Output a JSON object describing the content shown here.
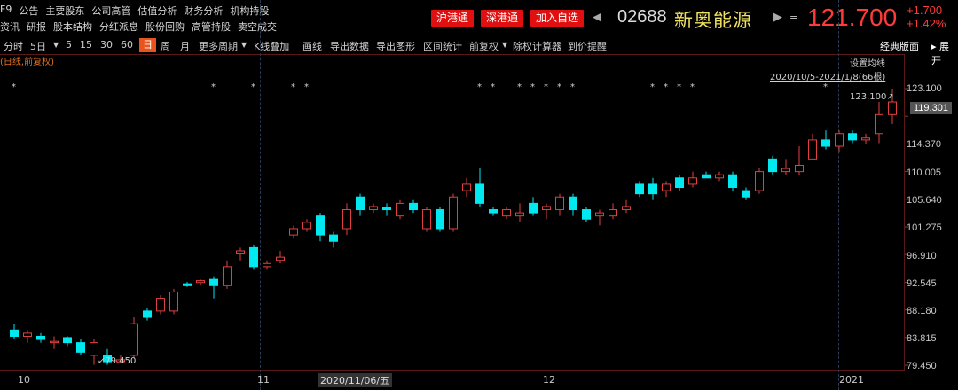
{
  "menu": {
    "row1": [
      "F9",
      "公告",
      "主要股东",
      "公司高管",
      "估值分析",
      "财务分析",
      "机构持股"
    ],
    "row2": [
      "资讯",
      "研报",
      "股本结构",
      "分红派息",
      "股份回购",
      "高管持股",
      "卖空成交"
    ]
  },
  "badges": [
    "沪港通",
    "深港通",
    "加入自选"
  ],
  "stock": {
    "code": "02688",
    "name": "新奥能源",
    "price": "121.700",
    "change": "+1.700",
    "change_pct": "+1.42%"
  },
  "toolbar": {
    "items": [
      "分时",
      "5日",
      "5",
      "15",
      "30",
      "60",
      "日",
      "周",
      "月",
      "更多周期",
      "K线叠加",
      "画线",
      "导出数据",
      "导出图形",
      "区间统计",
      "前复权",
      "除权计算器",
      "到价提醒"
    ],
    "active": "日",
    "right1": "经典版面",
    "right2": "展开"
  },
  "chart_labels": {
    "period_label": "(日线,前复权)",
    "set_ma": "设置均线",
    "range": "2020/10/5-2021/1/8(66根)",
    "high_label": "123.100",
    "low_label": "79.450",
    "current_tag": "119.301"
  },
  "colors": {
    "up": "#e04040",
    "down": "#00e8f0",
    "bg": "#000000",
    "accent": "#ff3a3a"
  },
  "chart_data": {
    "type": "candlestick",
    "yticks": [
      "123.100",
      "118.735",
      "114.370",
      "110.005",
      "105.640",
      "101.275",
      "96.910",
      "92.545",
      "88.180",
      "83.815",
      "79.450"
    ],
    "ylim": [
      79.45,
      123.1
    ],
    "xticks": [
      "10",
      "11",
      "2020/11/06/五",
      "12",
      "2021"
    ],
    "candles": [
      [
        85,
        84,
        86,
        83.5,
        0
      ],
      [
        84,
        84.5,
        85,
        83,
        1
      ],
      [
        84,
        83.5,
        84.5,
        83,
        0
      ],
      [
        83,
        83.2,
        84,
        82,
        1
      ],
      [
        83,
        83.8,
        84,
        82.5,
        0
      ],
      [
        83,
        81.5,
        83.5,
        81,
        0
      ],
      [
        81,
        83,
        83.5,
        79.5,
        1
      ],
      [
        81,
        80,
        82,
        79.5,
        0
      ],
      [
        80,
        80.3,
        81,
        79.8,
        1
      ],
      [
        81,
        86,
        87,
        80.5,
        1
      ],
      [
        87,
        88,
        88.5,
        86.5,
        0
      ],
      [
        88,
        90,
        90.5,
        87.5,
        1
      ],
      [
        88,
        91,
        91.5,
        87.5,
        1
      ],
      [
        92,
        92.3,
        92.6,
        91.8,
        0
      ],
      [
        92.5,
        92.8,
        93,
        92,
        1
      ],
      [
        93,
        92,
        93.5,
        90,
        0
      ],
      [
        92,
        95,
        96,
        91.5,
        1
      ],
      [
        97,
        97.5,
        98,
        96,
        1
      ],
      [
        98,
        95,
        98.5,
        94.5,
        0
      ],
      [
        95,
        95.5,
        96,
        94.5,
        1
      ],
      [
        96,
        96.5,
        97.5,
        95.5,
        1
      ],
      [
        100,
        101,
        101.5,
        99.5,
        1
      ],
      [
        101,
        102,
        102.5,
        100.5,
        1
      ],
      [
        103,
        100,
        103.5,
        99,
        0
      ],
      [
        100,
        99,
        100.5,
        98,
        0
      ],
      [
        101,
        104,
        105,
        100,
        1
      ],
      [
        106,
        104,
        106.5,
        103,
        0
      ],
      [
        104,
        104.5,
        105,
        103.5,
        1
      ],
      [
        104,
        104.3,
        105,
        103,
        0
      ],
      [
        103,
        105,
        105.5,
        102.5,
        1
      ],
      [
        105,
        104,
        105.5,
        103.5,
        0
      ],
      [
        101,
        104,
        104.5,
        100.5,
        1
      ],
      [
        104,
        101,
        104.5,
        100.5,
        0
      ],
      [
        101,
        106,
        106.5,
        100.5,
        1
      ],
      [
        107,
        108,
        109,
        106,
        1
      ],
      [
        108,
        105,
        110.5,
        104.5,
        0
      ],
      [
        104,
        103.5,
        104.5,
        103,
        0
      ],
      [
        103,
        104,
        104.5,
        102.5,
        1
      ],
      [
        103,
        103.5,
        105,
        102,
        1
      ],
      [
        105,
        103.5,
        106,
        103,
        0
      ],
      [
        104,
        104.5,
        105,
        102.5,
        1
      ],
      [
        104,
        106,
        106.5,
        103,
        1
      ],
      [
        106,
        104,
        106.5,
        103,
        0
      ],
      [
        104,
        102.5,
        104.5,
        102,
        0
      ],
      [
        103,
        103.5,
        104,
        101.5,
        1
      ],
      [
        103,
        104,
        105,
        102.5,
        1
      ],
      [
        104,
        104.5,
        105.5,
        103.5,
        1
      ],
      [
        108,
        106.5,
        108.5,
        106,
        0
      ],
      [
        108,
        106.5,
        109,
        105.5,
        0
      ],
      [
        107,
        108,
        108.5,
        106,
        1
      ],
      [
        109,
        107.5,
        109.5,
        107,
        0
      ],
      [
        108,
        109,
        110,
        107.5,
        1
      ],
      [
        109,
        109.5,
        110,
        109,
        0
      ],
      [
        109,
        109.5,
        110,
        108.5,
        1
      ],
      [
        109.5,
        107.5,
        110,
        107,
        0
      ],
      [
        107,
        106,
        107.5,
        105.5,
        0
      ],
      [
        107,
        110,
        110.5,
        106.5,
        1
      ],
      [
        112,
        110,
        112.5,
        109.5,
        0
      ],
      [
        110,
        110.5,
        112,
        109.5,
        1
      ],
      [
        110,
        111,
        114,
        109.5,
        1
      ],
      [
        112,
        115,
        116,
        112,
        1
      ],
      [
        115,
        114,
        116.5,
        113.5,
        0
      ],
      [
        114,
        116,
        116.5,
        113,
        1
      ],
      [
        116,
        115,
        116.5,
        114.5,
        0
      ],
      [
        115,
        115.3,
        116,
        114.3,
        1
      ],
      [
        116,
        119,
        121,
        114.5,
        1
      ],
      [
        119,
        121,
        123.1,
        117.5,
        1
      ]
    ],
    "markers_count": 20
  }
}
